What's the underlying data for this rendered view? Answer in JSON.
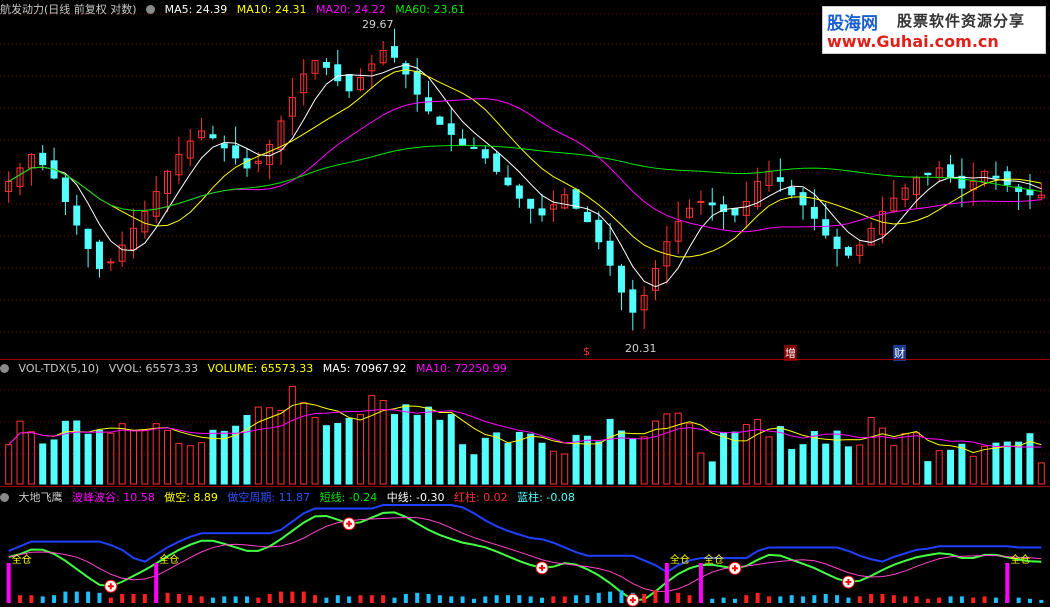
{
  "main": {
    "title": "航发动力(日线 前复权 对数)",
    "ma5": "MA5: 24.39",
    "ma10": "MA10: 24.31",
    "ma20": "MA20: 24.22",
    "ma60": "MA60: 23.61",
    "high_label": "29.67",
    "low_label": "20.31",
    "markers": [
      "$",
      "增",
      "财"
    ]
  },
  "watermark": {
    "brand": "股海网",
    "slogan": "股票软件资源分享",
    "url": "www.Guhai.com.cn"
  },
  "vol_panel": {
    "title": "VOL-TDX(5,10)",
    "vvol": "VVOL: 65573.33",
    "volume": "VOLUME: 65573.33",
    "ma5": "MA5: 70967.92",
    "ma10": "MA10: 72250.99"
  },
  "ind_panel": {
    "title": "大地飞鹰",
    "wave": "波峰波谷: 10.58",
    "short": "做空: 8.89",
    "cycle": "做空周期: 11.87",
    "dx": "短线: -0.24",
    "zx": "中线: -0.30",
    "red": "红柱: 0.02",
    "blue": "蓝柱: -0.08",
    "tag_label": "全仓"
  },
  "colors": {
    "up": "#ff3232",
    "down": "#54ffff",
    "ma5": "#ffffff",
    "ma10": "#ffff00",
    "ma20": "#ff00ff",
    "ma60": "#00e600",
    "grid": "#7a0000"
  },
  "chart_data": [
    {
      "type": "candlestick",
      "title": "航发动力(日线 前复权 对数)",
      "ylim": [
        20.31,
        29.67
      ],
      "annotations": [
        "29.67",
        "20.31"
      ],
      "series": [
        {
          "name": "MA5",
          "values": [
            24.39
          ]
        },
        {
          "name": "MA10",
          "values": [
            24.31
          ]
        },
        {
          "name": "MA20",
          "values": [
            24.22
          ]
        },
        {
          "name": "MA60",
          "values": [
            23.61
          ]
        }
      ],
      "close": [
        24.8,
        25.2,
        25.6,
        25.3,
        24.9,
        24.2,
        23.5,
        22.8,
        22.2,
        22.4,
        22.9,
        23.4,
        23.9,
        24.5,
        25.1,
        25.6,
        26.0,
        26.3,
        26.1,
        25.8,
        25.5,
        25.2,
        25.4,
        25.9,
        26.6,
        27.3,
        28.0,
        28.4,
        28.2,
        27.8,
        27.5,
        27.9,
        28.3,
        28.7,
        28.5,
        28.0,
        27.4,
        26.9,
        26.5,
        26.2,
        25.9,
        25.8,
        25.5,
        25.1,
        24.7,
        24.3,
        24.0,
        23.8,
        24.1,
        24.4,
        24.0,
        23.6,
        23.0,
        22.3,
        21.5,
        20.9,
        21.4,
        22.2,
        23.0,
        23.6,
        24.0,
        24.2,
        24.1,
        23.9,
        23.8,
        24.2,
        24.8,
        25.1,
        24.8,
        24.4,
        24.1,
        23.7,
        23.2,
        22.8,
        22.6,
        22.9,
        23.4,
        23.9,
        24.3,
        24.6,
        24.9,
        25.0,
        25.2,
        24.9,
        24.6,
        24.8,
        25.1,
        24.9,
        24.7,
        24.5,
        24.4,
        24.39
      ]
    },
    {
      "type": "bar",
      "title": "VOL-TDX(5,10)",
      "series": [
        {
          "name": "VOLUME",
          "values": [
            65573.33
          ]
        },
        {
          "name": "MA5",
          "values": [
            70967.92
          ]
        },
        {
          "name": "MA10",
          "values": [
            72250.99
          ]
        }
      ]
    },
    {
      "type": "line",
      "title": "大地飞鹰",
      "series": [
        {
          "name": "波峰波谷",
          "values": [
            10.58
          ]
        },
        {
          "name": "做空",
          "values": [
            8.89
          ]
        },
        {
          "name": "做空周期",
          "values": [
            11.87
          ]
        },
        {
          "name": "短线",
          "values": [
            -0.24
          ]
        },
        {
          "name": "中线",
          "values": [
            -0.3
          ]
        },
        {
          "name": "红柱",
          "values": [
            0.02
          ]
        },
        {
          "name": "蓝柱",
          "values": [
            -0.08
          ]
        }
      ]
    }
  ]
}
